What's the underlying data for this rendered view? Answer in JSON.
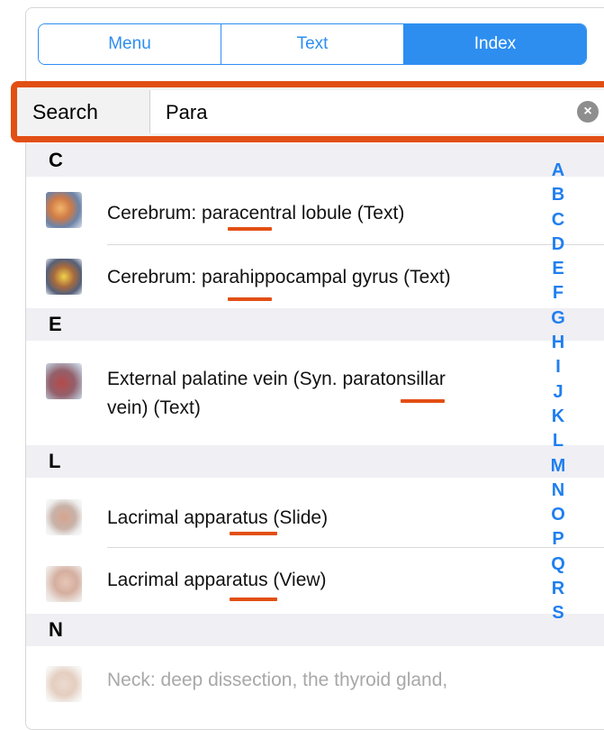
{
  "tabs": [
    "Menu",
    "Text",
    "Index"
  ],
  "search": {
    "label": "Search",
    "value": "Para",
    "clear": "×"
  },
  "sections": {
    "c": "C",
    "e": "E",
    "l": "L",
    "n": "N"
  },
  "rows": [
    {
      "text": "Cerebrum: paracentral lobule (Text)"
    },
    {
      "text": "Cerebrum: parahippocampal gyrus (Text)"
    },
    {
      "line1": "External palatine vein (Syn. paratonsillar",
      "line2": "vein) (Text)"
    },
    {
      "text": "Lacrimal apparatus (Slide)"
    },
    {
      "text": "Lacrimal apparatus (View)"
    },
    {
      "text": "Neck: deep dissection, the thyroid gland,"
    }
  ],
  "index_letters": [
    "A",
    "B",
    "C",
    "D",
    "E",
    "F",
    "G",
    "H",
    "I",
    "J",
    "K",
    "L",
    "M",
    "N",
    "O",
    "P",
    "Q",
    "R",
    "S"
  ],
  "colors": {
    "accent": "#2d8ef0",
    "highlight": "#e24f14",
    "section_bg": "#efeff4"
  }
}
